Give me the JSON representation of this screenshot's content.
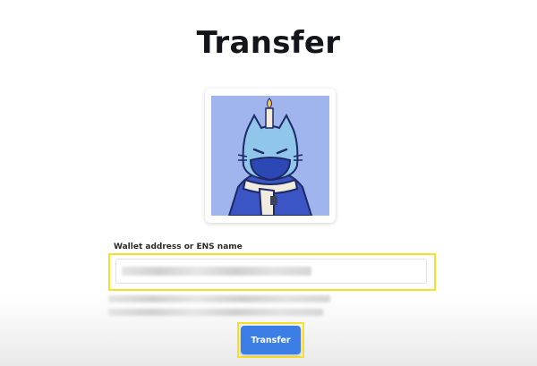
{
  "page": {
    "title": "Transfer"
  },
  "nft": {
    "image_description_icon": "cat-with-candle-and-scarf-nft"
  },
  "wallet_field": {
    "label": "Wallet address or ENS name",
    "value_state": "redacted-blurred"
  },
  "transfer_button": {
    "label": "Transfer"
  },
  "colors": {
    "title": "#14141c",
    "button_bg": "#3a7ee6",
    "button_text": "#ffffff",
    "highlight": "#f4e12a",
    "nft_background": "#a0b4ee"
  }
}
